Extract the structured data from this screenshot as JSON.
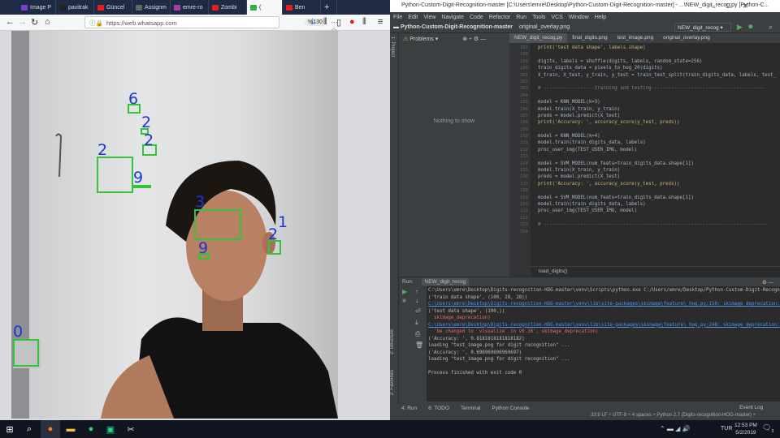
{
  "browser": {
    "tabs": [
      {
        "label": "Image P",
        "color": "#7b3fd0"
      },
      {
        "label": "pavitrak",
        "color": "#222"
      },
      {
        "label": "Güncel",
        "color": "#e02020"
      },
      {
        "label": "Assignm",
        "color": "#666"
      },
      {
        "label": "emre-ro",
        "color": "#a040a0"
      },
      {
        "label": "Zombi",
        "color": "#e02020"
      },
      {
        "label": "(",
        "color": "#2fb04a",
        "active": true
      },
      {
        "label": "Ben",
        "color": "#e02020"
      }
    ],
    "url": "https://web.whatsapp.com",
    "zoom": "%130",
    "new_tab": "+",
    "webcam": {
      "detections": [
        {
          "digit": "6"
        },
        {
          "digit": "2"
        },
        {
          "digit": "2"
        },
        {
          "digit": "2"
        },
        {
          "digit": "9"
        },
        {
          "digit": "3"
        },
        {
          "digit": "1"
        },
        {
          "digit": "2"
        },
        {
          "digit": "9"
        },
        {
          "digit": "0"
        }
      ]
    }
  },
  "ide": {
    "title": "Python-Custom-Digit-Recognition-master [C:\\Users\\emre\\Desktop\\Python-Custom-Digit-Recognition-master] - ...\\NEW_digit_recog.py [Python-C...",
    "menu": [
      "File",
      "Edit",
      "View",
      "Navigate",
      "Code",
      "Refactor",
      "Run",
      "Tools",
      "VCS",
      "Window",
      "Help"
    ],
    "project": "Python-Custom-Digit-Recognition-master",
    "nav_file": "original_overlay.png",
    "run_config": "NEW_digit_recog",
    "side_label": "1: Project",
    "problems_label": "Problems",
    "problems_empty": "Nothing to show",
    "editor_tabs": [
      "NEW_digit_recog.py",
      "final_digits.png",
      "test_image.png",
      "original_overlay.png"
    ],
    "line_numbers": [
      "197",
      "198",
      "199",
      "200",
      "201",
      "202",
      "203",
      "204",
      "205",
      "206",
      "207",
      "208",
      "209",
      "210",
      "211",
      "212",
      "213",
      "214",
      "215",
      "216",
      "217",
      "218",
      "219",
      "220",
      "221",
      "222",
      "223",
      "224"
    ],
    "code_lines": [
      "print('test data shape', labels.shape)",
      "",
      "digits, labels = shuffle(digits, labels, random_state=256)",
      "train_digits_data = pixels_to_hog_20(digits)",
      "X_train, X_test, y_train, y_test = train_test_split(train_digits_data, labels, test_",
      "",
      "# ------------------training and testing----------------------------------------",
      "",
      "model = KNN_MODEL(k=3)",
      "model.train(X_train, y_train)",
      "preds = model.predict(X_test)",
      "print('Accuracy: ', accuracy_score(y_test, preds))",
      "",
      "model = KNN_MODEL(k=4)",
      "model.train(train_digits_data, labels)",
      "proc_user_img(TEST_USER_IMG, model)",
      "",
      "model = SVM_MODEL(num_feats=train_digits_data.shape[1])",
      "model.train(X_train, y_train)",
      "preds = model.predict(X_test)",
      "print('Accuracy: ', accuracy_score(y_test, preds))",
      "",
      "model = SVM_MODEL(num_feats=train_digits_data.shape[1])",
      "model.train(train_digits_data, labels)",
      "proc_user_img(TEST_USER_IMG, model)",
      "",
      "# -------------------------------------------------------------------------------",
      ""
    ],
    "breadcrumb": "load_digits()",
    "run_label": "Run:",
    "run_tab": "NEW_digit_recog",
    "console": [
      {
        "t": "C:\\Users\\emre\\Desktop\\Digits-recognition-HOG-master\\venv\\Scripts\\python.exe C:/Users/emre/Desktop/Python-Custom-Digit-Recogn",
        "c": ""
      },
      {
        "t": "('train data shape', (100, 28, 28))",
        "c": ""
      },
      {
        "t": "C:\\Users\\emre\\Desktop\\Digits-recognition-HOG-master\\venv\\lib\\site-packages\\skimage\\feature\\_hog.py:150: skimage_deprecation:",
        "c": "lnk"
      },
      {
        "t": "('test data shape', (100,))",
        "c": ""
      },
      {
        "t": "  skimage_deprecation)",
        "c": "err"
      },
      {
        "t": "C:\\Users\\emre\\Desktop\\Digits-recognition-HOG-master\\venv\\lib\\site-packages\\skimage\\feature\\_hog.py:248: skimage_deprecation:",
        "c": "lnk"
      },
      {
        "t": "  'be changed to `visualize` in v0.16', skimage_deprecation)",
        "c": "err"
      },
      {
        "t": "('Accuracy: ', 0.8181818181818182)",
        "c": ""
      },
      {
        "t": "loading \"test_image.png for digit recognition\" ...",
        "c": ""
      },
      {
        "t": "('Accuracy: ', 0.696969696969697)",
        "c": ""
      },
      {
        "t": "loading \"test_image.png for digit recognition\" ...",
        "c": ""
      },
      {
        "t": "",
        "c": ""
      },
      {
        "t": "Process finished with exit code 0",
        "c": ""
      }
    ],
    "bottom_tabs": [
      "4: Run",
      "6: TODO",
      "Terminal",
      "Python Console"
    ],
    "event_log": "Event Log",
    "structure_label": "2: Structure",
    "favorites_label": "2: Favorites",
    "status": "33:9   LF ÷   UTF-8 ÷   4 spaces ÷   Python 2.7 (Digits-recognition-HOG-master) ÷"
  },
  "taskbar": {
    "language": "TUR",
    "time": "12:53 PM",
    "date": "5/2/2019",
    "notifications": "3"
  }
}
